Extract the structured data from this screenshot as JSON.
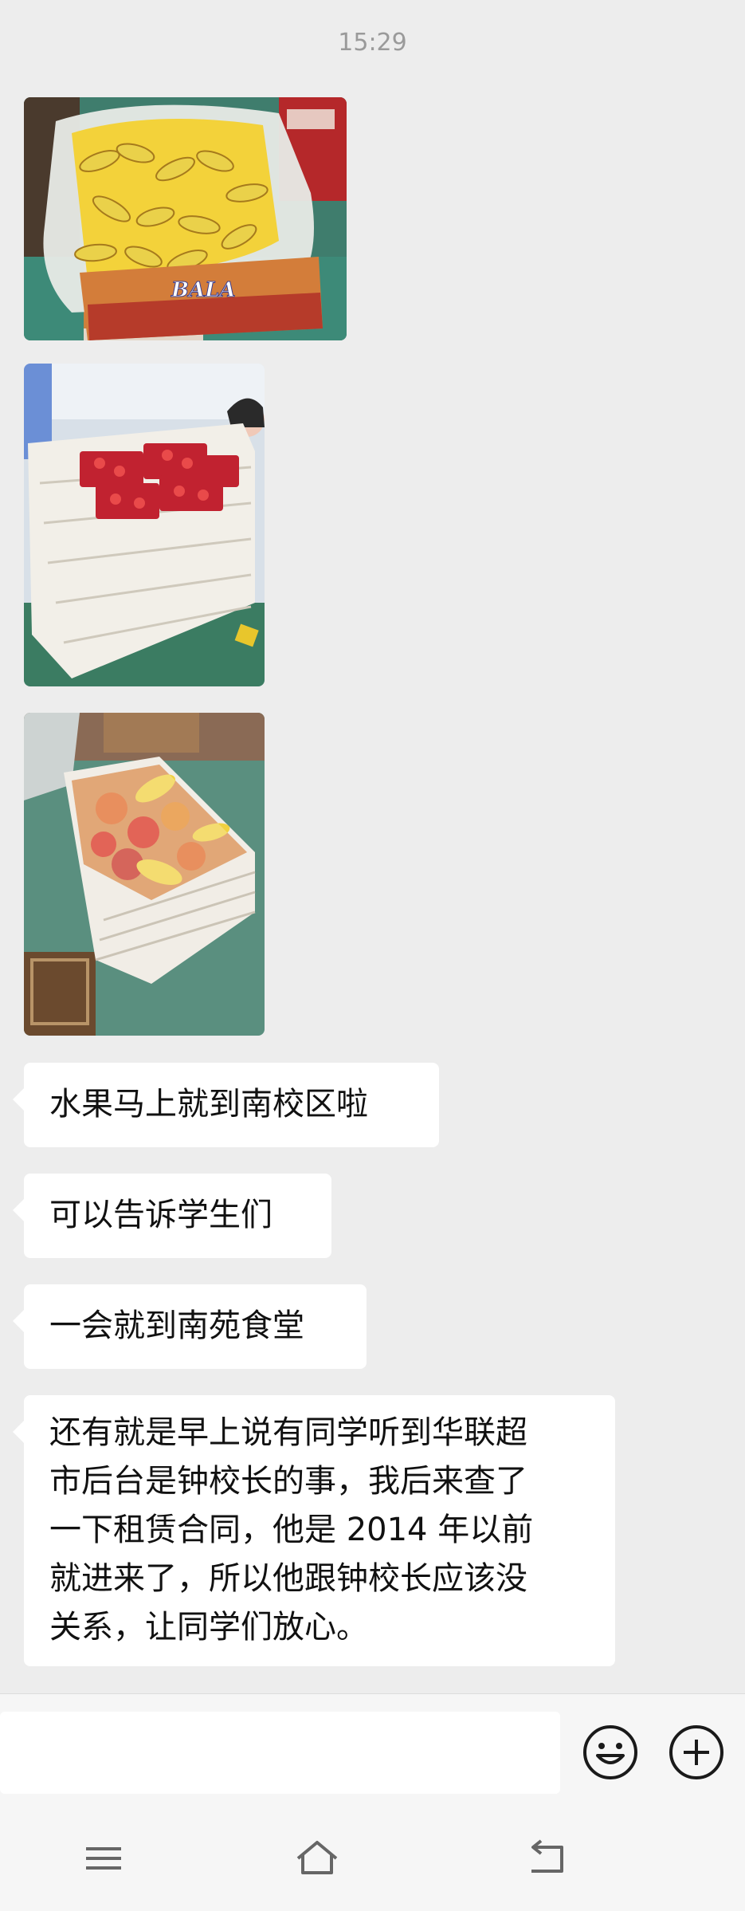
{
  "chat": {
    "timestamp": "15:29",
    "messages": [
      {
        "type": "image",
        "subject": "bananas-photo",
        "box_label": "BALA"
      },
      {
        "type": "image",
        "subject": "strawberries-photo"
      },
      {
        "type": "image",
        "subject": "mixed-fruit-photo"
      },
      {
        "type": "text",
        "lines": [
          "水果马上就到南校区啦"
        ]
      },
      {
        "type": "text",
        "lines": [
          "可以告诉学生们"
        ]
      },
      {
        "type": "text",
        "lines": [
          "一会就到南苑食堂"
        ]
      },
      {
        "type": "text",
        "lines": [
          "还有就是早上说有同学听到华联超",
          "市后台是钟校长的事，我后来查了",
          "一下租赁合同，他是 2014 年以前",
          "就进来了，所以他跟钟校长应该没",
          "关系，让同学们放心。"
        ]
      }
    ]
  },
  "input_bar": {
    "text": "",
    "emoji_icon": "smiley-face-icon",
    "plus_icon": "plus-circle-icon"
  },
  "nav": {
    "menu_icon": "menu-icon",
    "home_icon": "home-icon",
    "back_icon": "back-icon"
  },
  "colors": {
    "background": "#ededed",
    "bubble": "#ffffff",
    "timestamp": "#9a9a9a",
    "text": "#111111",
    "bars": "#f6f6f6"
  }
}
